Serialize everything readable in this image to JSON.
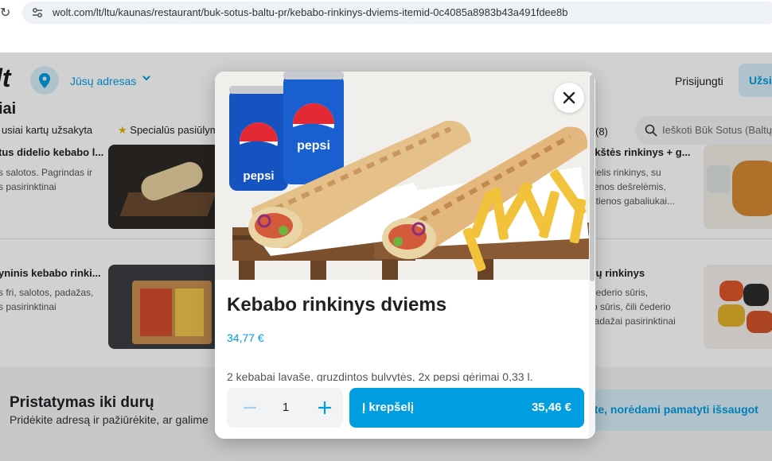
{
  "browser": {
    "url": "wolt.com/lt/ltu/kaunas/restaurant/buk-sotus-baltu-pr/kebabo-rinkinys-dviems-itemid-0c4085a8983b43a491fdee8b"
  },
  "header": {
    "logo": "lt",
    "address_label": "Jūsų adresas",
    "login_label": "Prisijungti",
    "signup_label": "Užsi"
  },
  "menu": {
    "section_title": "iai",
    "tabs": [
      "usiai kartų užsakyta",
      "Specialūs pasiūlym",
      "(8)"
    ],
    "search_placeholder": "Ieškoti Būk Sotus (Baltų"
  },
  "cards": [
    {
      "title": "tus didelio kebabo l...",
      "desc": [
        "s salotos. Pagrindas ir",
        "s pasirinktinai"
      ]
    },
    {
      "title": "ykštės rinkinys + g...",
      "desc": [
        "idelis rinkinys, su",
        "tienos dešrelėmis,",
        "ištienos gabaliukai..."
      ]
    },
    {
      "title": "yninis kebabo rinki...",
      "desc": [
        "s fri, salotos, padažas,",
        "s pasirinktinai"
      ]
    },
    {
      "title": "rių rinkinys",
      "desc": [
        "Čederio sūris,",
        "ro sūris, čili čederio",
        "padažai pasirinktinai"
      ]
    }
  ],
  "delivery": {
    "title": "Pristatymas iki durų",
    "text": "Pridėkite adresą ir pažiūrėkite, ar galime",
    "cta": "kite, norėdami pamatyti išsaugot"
  },
  "modal": {
    "title": "Kebabo rinkinys dviems",
    "price": "34,77 €",
    "description": "2 kebabai lavaše, gruzdintos bulvytės, 2x pepsi gėrimai 0,33 l.",
    "quantity": "1",
    "add_label": "Į krepšelį",
    "total": "35,46 €",
    "can_brand": "pepsi"
  },
  "colors": {
    "accent": "#009de0",
    "accent_light": "#d7eefb"
  }
}
